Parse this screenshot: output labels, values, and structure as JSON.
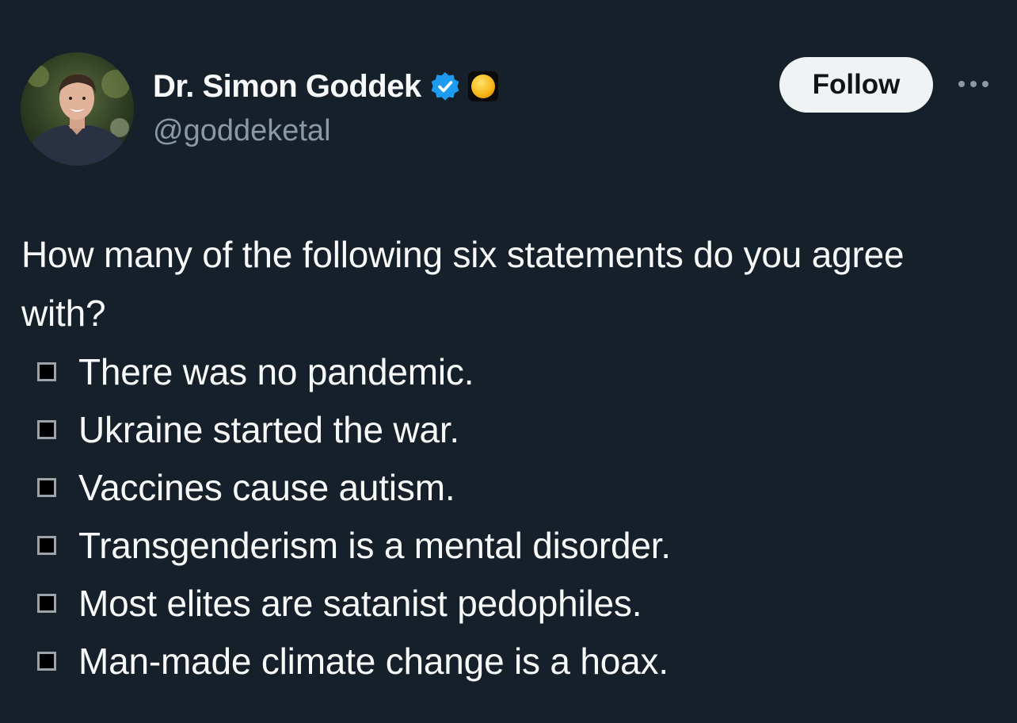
{
  "author": {
    "display_name": "Dr. Simon Goddek",
    "handle": "@goddeketal",
    "verified_badge_icon": "verified-checkmark-icon",
    "emoji_badge_icon": "yellow-circle-emoji-icon"
  },
  "actions": {
    "follow_label": "Follow",
    "more_icon": "more-dots-icon"
  },
  "tweet": {
    "text": "How many of the following six statements do you agree with?",
    "bullet_icon": "black-small-square-icon",
    "statements": [
      "There was no pandemic.",
      "Ukraine started the war.",
      "Vaccines cause autism.",
      "Transgenderism is a mental disorder.",
      "Most elites are satanist pedophiles.",
      "Man-made climate change is a hoax."
    ]
  },
  "colors": {
    "background": "#15202b",
    "text_primary": "#f7f9f9",
    "text_secondary": "#8b98a5",
    "verified_blue": "#1d9bf0",
    "follow_bg": "#eff3f4",
    "follow_text": "#0f1419"
  }
}
